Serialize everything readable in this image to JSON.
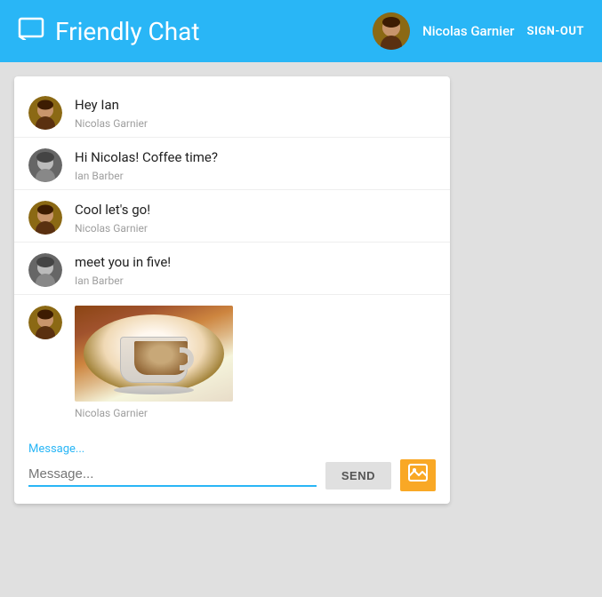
{
  "header": {
    "title": "Friendly Chat",
    "icon": "💬",
    "user": {
      "name": "Nicolas Garnier",
      "signout_label": "SIGN-OUT"
    }
  },
  "messages": [
    {
      "id": 1,
      "text": "Hey Ian",
      "sender": "Nicolas Garnier",
      "avatar_type": "nicolas"
    },
    {
      "id": 2,
      "text": "Hi Nicolas! Coffee time?",
      "sender": "Ian Barber",
      "avatar_type": "ian"
    },
    {
      "id": 3,
      "text": "Cool let's go!",
      "sender": "Nicolas Garnier",
      "avatar_type": "nicolas"
    },
    {
      "id": 4,
      "text": "meet you in five!",
      "sender": "Ian Barber",
      "avatar_type": "ian"
    },
    {
      "id": 5,
      "text": "",
      "sender": "Nicolas Garnier",
      "avatar_type": "nicolas",
      "is_image": true
    }
  ],
  "input": {
    "label": "Message...",
    "placeholder": "Message...",
    "send_label": "SEND"
  }
}
